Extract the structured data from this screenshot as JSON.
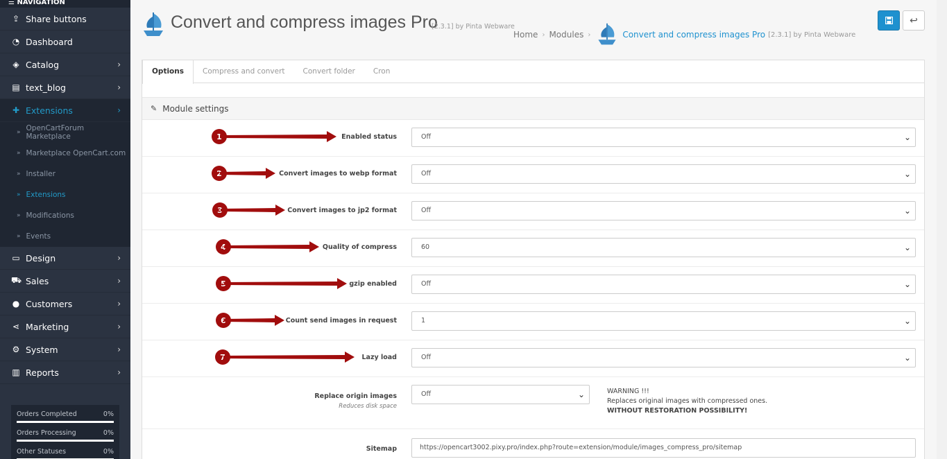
{
  "sidebar": {
    "title": "NAVIGATION",
    "items": [
      {
        "label": "Share buttons",
        "icon": "share-icon",
        "chevron": false
      },
      {
        "label": "Dashboard",
        "icon": "dashboard-icon",
        "chevron": false
      },
      {
        "label": "Catalog",
        "icon": "tag-icon",
        "chevron": true
      },
      {
        "label": "text_blog",
        "icon": "book-icon",
        "chevron": true
      },
      {
        "label": "Extensions",
        "icon": "puzzle-icon",
        "chevron": true,
        "active": true
      }
    ],
    "sub_items": [
      {
        "label": "OpenCartForum Marketplace"
      },
      {
        "label": "Marketplace OpenCart.com"
      },
      {
        "label": "Installer"
      },
      {
        "label": "Extensions",
        "active": true
      },
      {
        "label": "Modifications"
      },
      {
        "label": "Events"
      }
    ],
    "items_bottom": [
      {
        "label": "Design",
        "icon": "desktop-icon"
      },
      {
        "label": "Sales",
        "icon": "cart-icon"
      },
      {
        "label": "Customers",
        "icon": "user-icon"
      },
      {
        "label": "Marketing",
        "icon": "share-alt-icon"
      },
      {
        "label": "System",
        "icon": "cog-icon"
      },
      {
        "label": "Reports",
        "icon": "bar-chart-icon"
      }
    ],
    "stats": [
      {
        "label": "Orders Completed",
        "value": "0%"
      },
      {
        "label": "Orders Processing",
        "value": "0%"
      },
      {
        "label": "Other Statuses",
        "value": "0%"
      }
    ]
  },
  "header": {
    "title": "Convert and compress images Pro",
    "version": "[2.3.1] by Pinta Webware",
    "breadcrumb": {
      "home": "Home",
      "modules": "Modules",
      "module": "Convert and compress images Pro",
      "module_version": "[2.3.1] by Pinta Webware"
    }
  },
  "tabs": [
    "Options",
    "Compress and convert",
    "Convert folder",
    "Cron"
  ],
  "panel_title": "Module settings",
  "settings": [
    {
      "num": "1",
      "label": "Enabled status",
      "value": "Off"
    },
    {
      "num": "2",
      "label": "Convert images to webp format",
      "value": "Off"
    },
    {
      "num": "3",
      "label": "Convert images to jp2 format",
      "value": "Off"
    },
    {
      "num": "4",
      "label": "Quality of compress",
      "value": "60"
    },
    {
      "num": "5",
      "label": "gzip enabled",
      "value": "Off"
    },
    {
      "num": "6",
      "label": "Count send images in request",
      "value": "1"
    },
    {
      "num": "7",
      "label": "Lazy load",
      "value": "Off"
    }
  ],
  "replace": {
    "label": "Replace origin images",
    "hint": "Reduces disk space",
    "value": "Off",
    "warning_title": "WARNING !!!",
    "warning_text": "Replaces original images with compressed ones.",
    "warning_bold": "WITHOUT RESTORATION POSSIBILITY!"
  },
  "sitemap": {
    "label": "Sitemap",
    "value": "https://opencart3002.pixy.pro/index.php?route=extension/module/images_compress_pro/sitemap"
  },
  "colors": {
    "accent": "#1e91cf",
    "sidebar": "#2b3341",
    "badge": "#a10d0d"
  }
}
